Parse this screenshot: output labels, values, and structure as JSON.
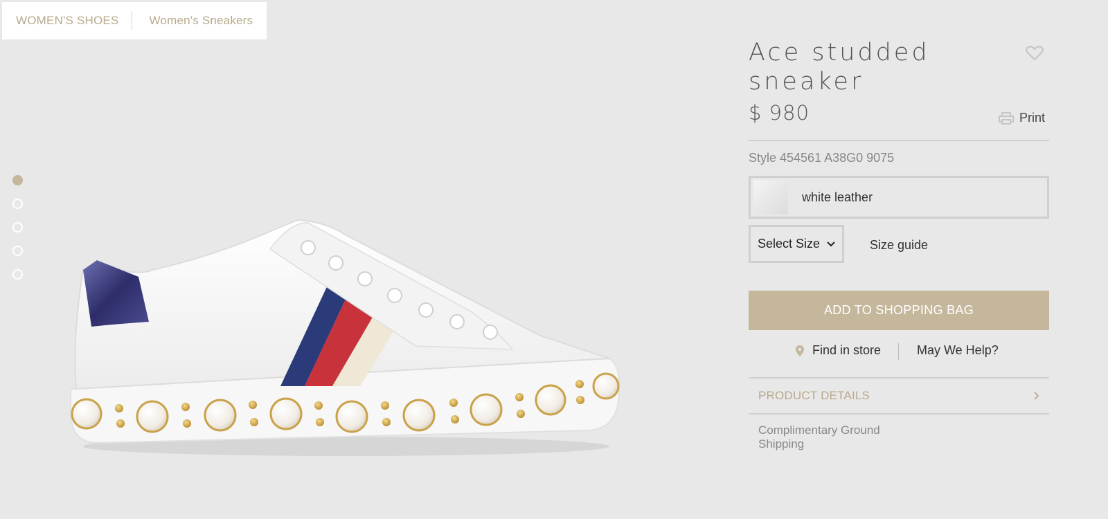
{
  "breadcrumb": {
    "items": [
      "WOMEN'S SHOES",
      "Women's Sneakers"
    ]
  },
  "carousel": {
    "total": 5,
    "active": 1
  },
  "product": {
    "title": "Ace studded sneaker",
    "price": "$ 980",
    "style": "Style 454561 A38G0 9075",
    "color": "white leather"
  },
  "actions": {
    "print_label": "Print",
    "size_select": "Select Size",
    "size_guide": "Size guide",
    "add_to_bag": "ADD TO SHOPPING BAG",
    "find_in_store": "Find in store",
    "help": "May We Help?"
  },
  "details": {
    "label": "PRODUCT DETAILS",
    "shipping": "Complimentary Ground Shipping"
  },
  "icons": {
    "wishlist": "heart-icon",
    "print": "printer-icon",
    "store": "location-pin-icon",
    "select": "chevron-down-icon",
    "details": "chevron-right-icon"
  },
  "colors": {
    "background": "#e8e8e8",
    "accent": "#c5b79c",
    "crumb_text": "#b8a98c",
    "rule": "#cfcfcf"
  }
}
